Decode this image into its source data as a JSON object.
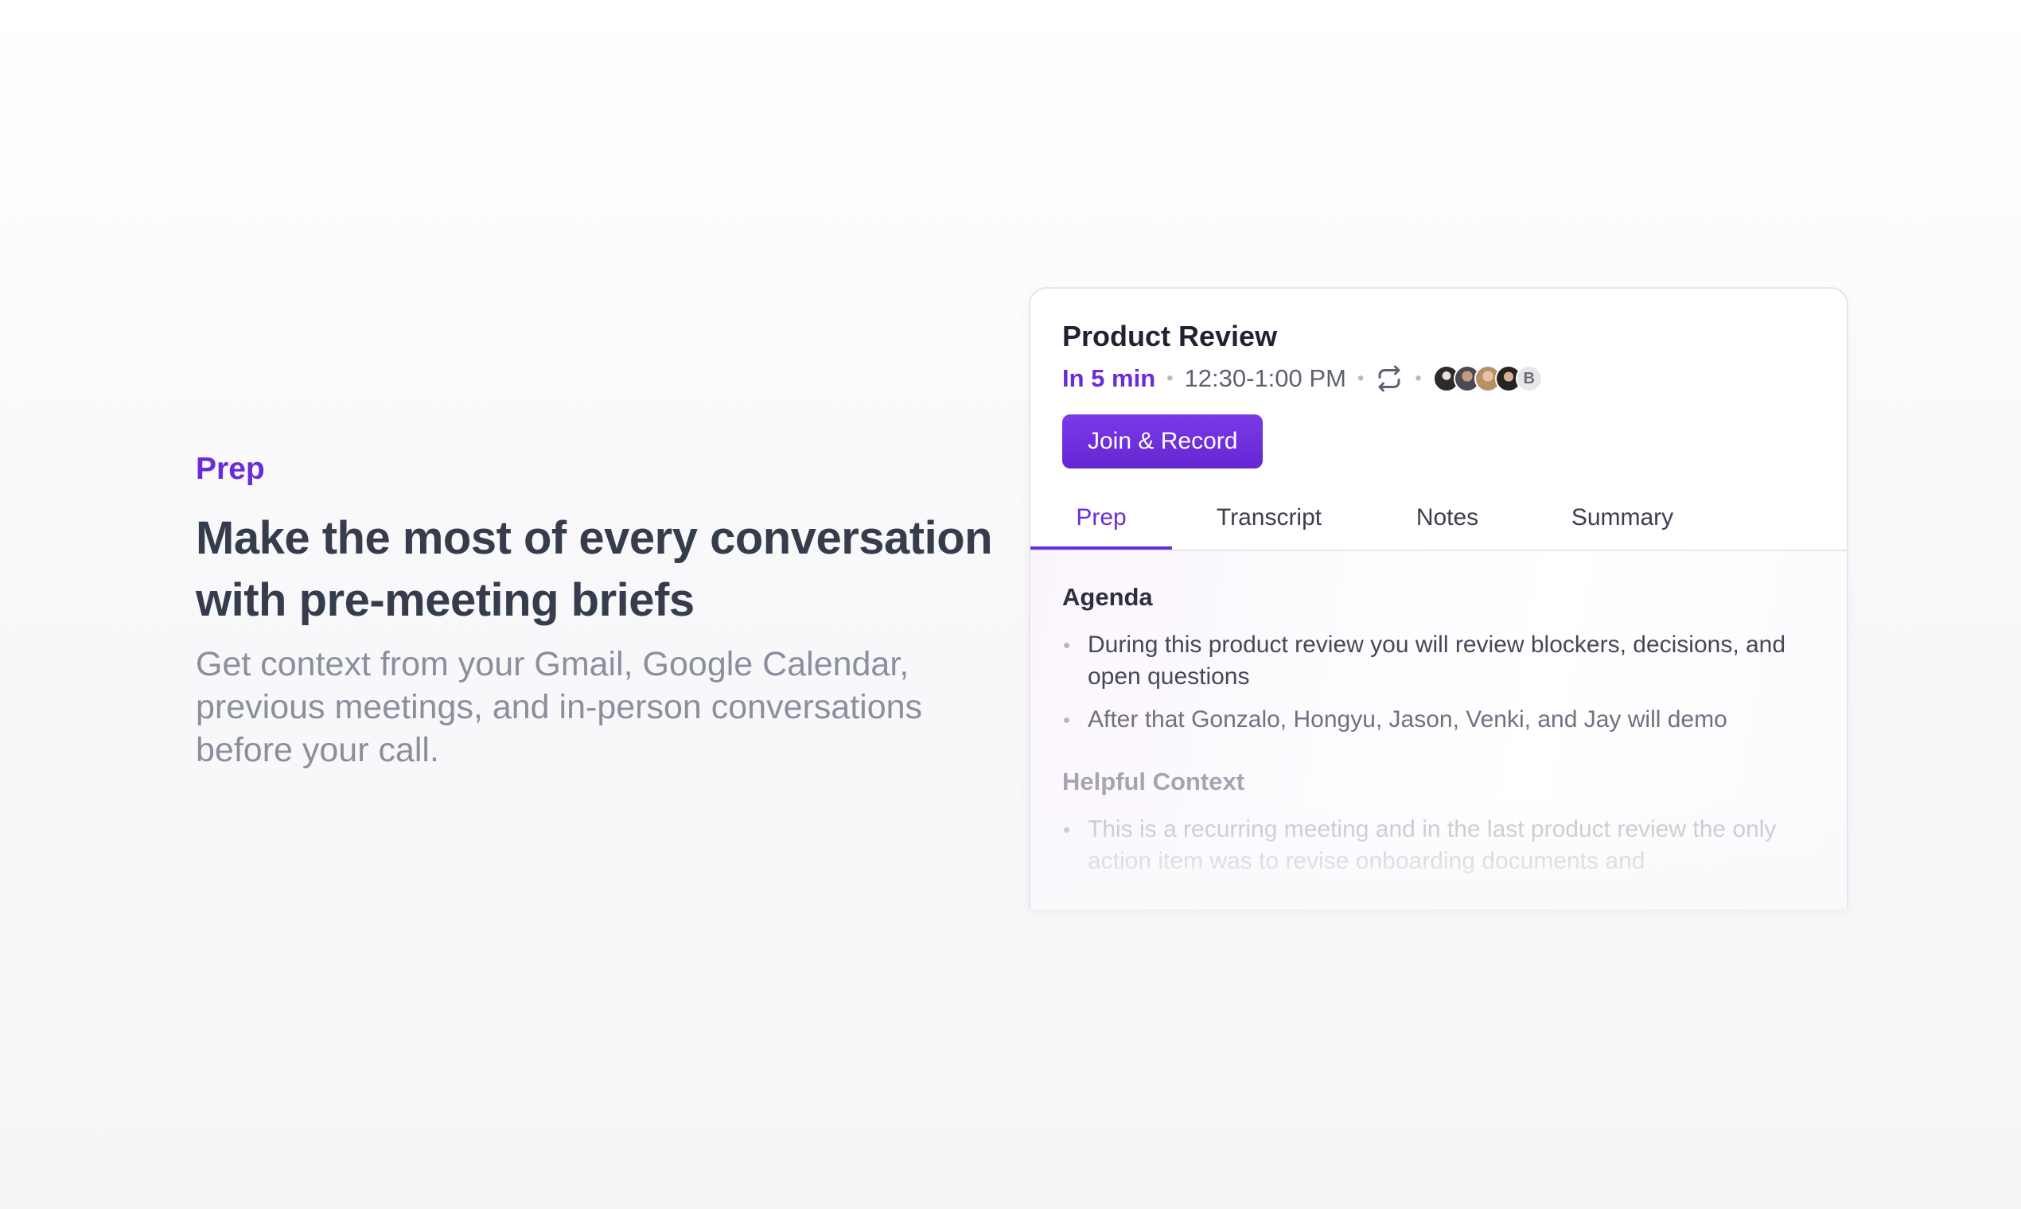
{
  "promo": {
    "eyebrow": "Prep",
    "headline_line1": "Make the most of every conversation",
    "headline_line2": "with pre-meeting briefs",
    "subcopy": "Get context from your Gmail, Google Calendar, previous meetings, and in-person conversations before your call."
  },
  "meeting": {
    "title": "Product Review",
    "countdown": "In 5 min",
    "time_range": "12:30-1:00 PM",
    "repeat_icon": "repeat-icon",
    "attendees_extra_initial": "B",
    "join_button_label": "Join & Record"
  },
  "tabs": [
    {
      "label": "Prep",
      "active": true
    },
    {
      "label": "Transcript",
      "active": false
    },
    {
      "label": "Notes",
      "active": false
    },
    {
      "label": "Summary",
      "active": false
    }
  ],
  "prep": {
    "agenda_title": "Agenda",
    "agenda_items": [
      "During this product review you will review blockers, decisions, and open questions",
      "After that Gonzalo, Hongyu, Jason, Venki, and Jay will demo"
    ],
    "helpful_title": "Helpful Context",
    "helpful_items": [
      "This is a recurring meeting and in the last product review the only action item was to revise onboarding documents and"
    ]
  },
  "colors": {
    "accent": "#6c2bd9",
    "headline": "#353d4d",
    "subcopy": "#8a8f9c"
  }
}
